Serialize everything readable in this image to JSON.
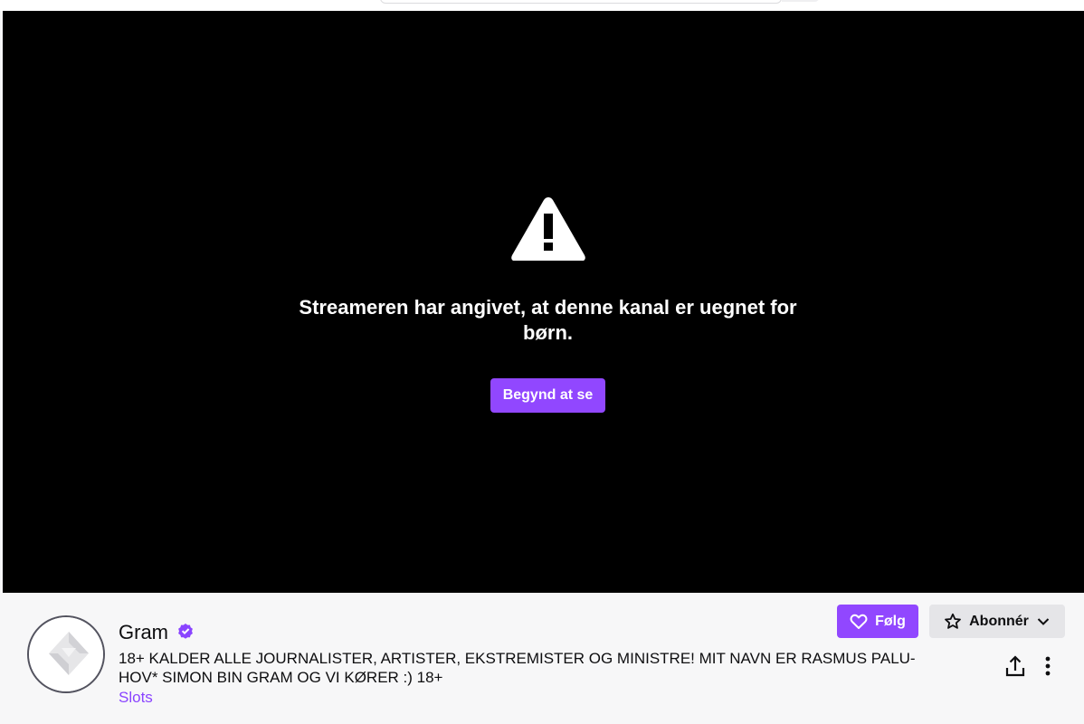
{
  "player": {
    "gate_message": "Streameren har angivet, at denne kanal er uegnet for børn.",
    "start_button_label": "Begynd at se",
    "warning_icon": "warning-triangle-icon"
  },
  "channel": {
    "name": "Gram",
    "verified_icon": "verified-badge-icon",
    "stream_title": "18+ KALDER ALLE JOURNALISTER, ARTISTER, EKSTREMISTER OG MINISTRE! MIT NAVN ER RASMUS PALU-HOV* SIMON BIN GRAM OG VI KØRER :) 18+",
    "category": "Slots"
  },
  "actions": {
    "follow_label": "Følg",
    "subscribe_label": "Abonnér",
    "share_icon": "share-icon",
    "more_icon": "more-options-icon"
  },
  "colors": {
    "accent": "#9147ff",
    "category_link": "#8a44ff",
    "player_background": "#000000",
    "info_background": "#f7f7f8",
    "subscribe_background": "#e5e5e8"
  }
}
